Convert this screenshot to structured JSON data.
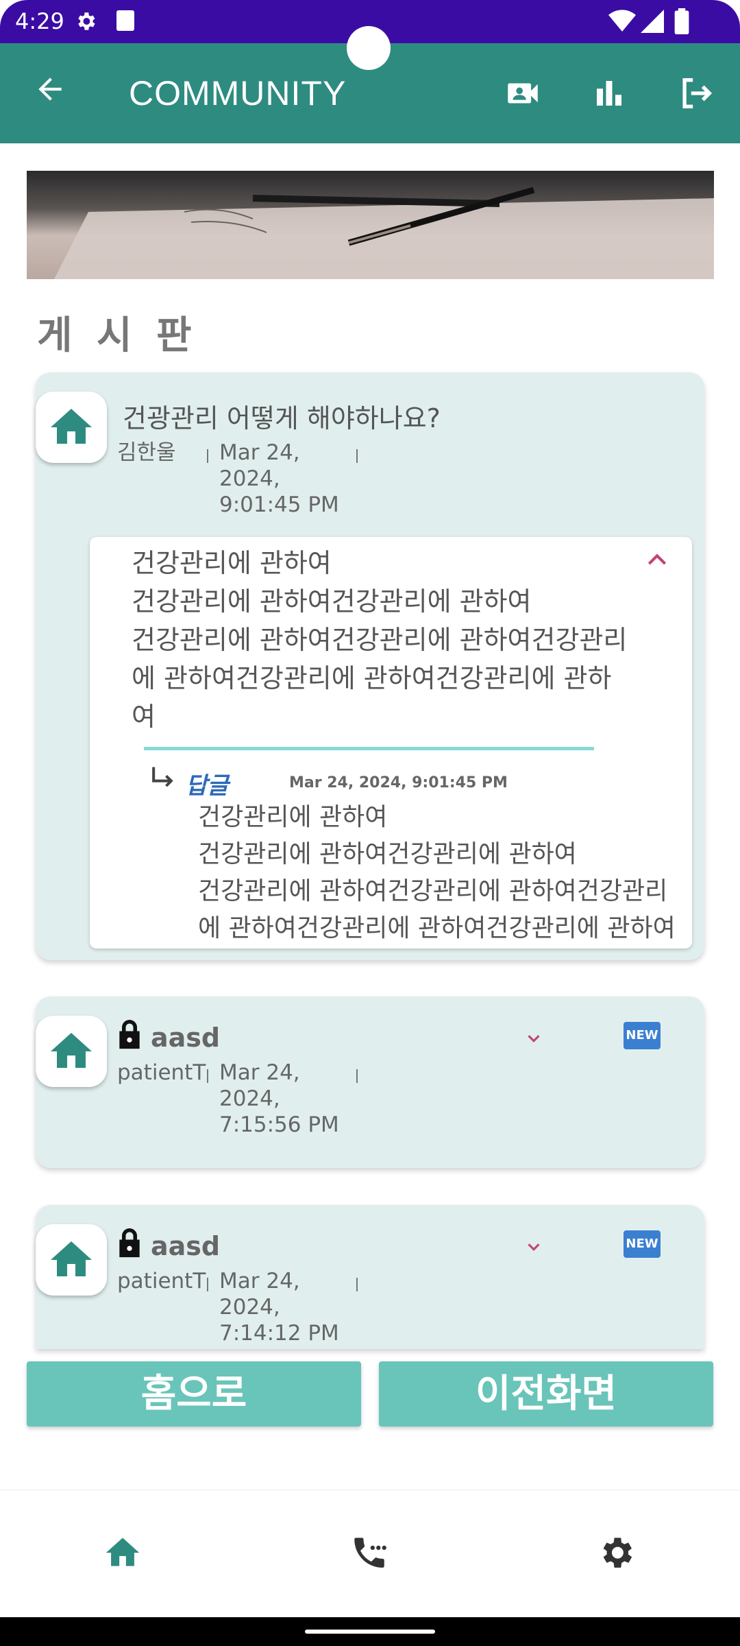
{
  "status_bar": {
    "time": "4:29",
    "icons": [
      "gear-icon",
      "a-icon",
      "wifi-icon",
      "signal-icon",
      "battery-icon"
    ]
  },
  "app_bar": {
    "title": "COMMUNITY",
    "icons": [
      "back-arrow-icon",
      "video-call-icon",
      "bar-chart-icon",
      "logout-icon"
    ]
  },
  "board": {
    "section_title": "게 시 판",
    "posts": [
      {
        "title": "건광관리 어떻게 해야하나요?",
        "author": "김한울",
        "date_line1": "Mar 24,",
        "date_line2": "2024,",
        "date_line3": "9:01:45 PM",
        "content": "건강관리에 관하여\n건강관리에 관하여건강관리에 관하여\n건강관리에 관하여건강관리에 관하여건강관리에 관하여건강관리에 관하여건강관리에 관하여",
        "reply": {
          "label": "답글",
          "date": "Mar 24, 2024, 9:01:45 PM",
          "text": "건강관리에 관하여\n건강관리에 관하여건강관리에 관하여\n건강관리에 관하여건강관리에 관하여건강관리에 관하여건강관리에 관하여건강관리에 관하여"
        }
      },
      {
        "title": "aasd",
        "author": "patientT",
        "date_line1": "Mar 24,",
        "date_line2": "2024,",
        "date_line3": "7:15:56 PM",
        "badge": "NEW"
      },
      {
        "title": "aasd",
        "author": "patientT",
        "date_line1": "Mar 24,",
        "date_line2": "2024,",
        "date_line3": "7:14:12 PM",
        "badge": "NEW"
      }
    ]
  },
  "buttons": {
    "home": "홈으로",
    "back": "이전화면"
  },
  "bottom_nav": [
    "home-icon",
    "phone-icon",
    "settings-icon"
  ],
  "colors": {
    "status_bar": "#3a0ca3",
    "app_bar": "#2e8b80",
    "card": "#e0efee",
    "button": "#69c4b9",
    "accent_pink": "#c2457a",
    "badge_blue": "#3b7fd0"
  }
}
